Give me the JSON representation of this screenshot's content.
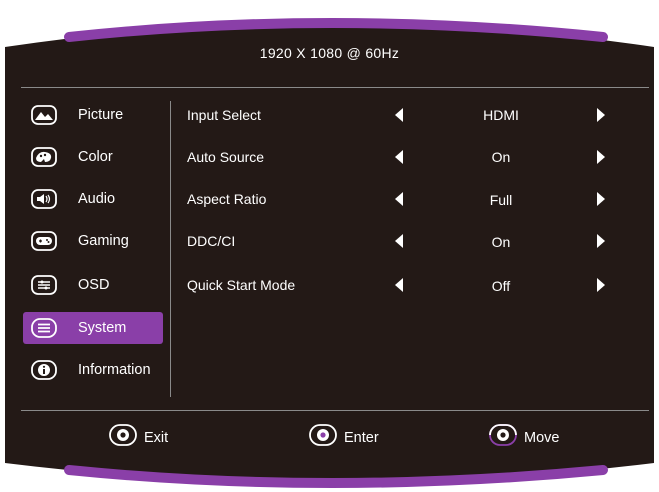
{
  "colors": {
    "panel": "#231916",
    "accent": "#8a3fa8",
    "text": "#ffffff",
    "divider": "#8a8a8a"
  },
  "header": {
    "resolution": "1920  X  1080  @  60Hz"
  },
  "sidebar": {
    "items": [
      {
        "label": "Picture",
        "icon": "mountain-icon",
        "active": false
      },
      {
        "label": "Color",
        "icon": "palette-icon",
        "active": false
      },
      {
        "label": "Audio",
        "icon": "speaker-icon",
        "active": false
      },
      {
        "label": "Gaming",
        "icon": "gamepad-icon",
        "active": false
      },
      {
        "label": "OSD",
        "icon": "sliders-icon",
        "active": false
      },
      {
        "label": "System",
        "icon": "menu-lines-icon",
        "active": true
      },
      {
        "label": "Information",
        "icon": "info-icon",
        "active": false
      }
    ]
  },
  "settings": {
    "rows": [
      {
        "label": "Input Select",
        "value": "HDMI"
      },
      {
        "label": "Auto Source",
        "value": "On"
      },
      {
        "label": "Aspect Ratio",
        "value": "Full"
      },
      {
        "label": "DDC/CI",
        "value": "On"
      },
      {
        "label": "Quick Start Mode",
        "value": "Off"
      }
    ]
  },
  "footer": {
    "exit_label": "Exit",
    "enter_label": "Enter",
    "move_label": "Move"
  }
}
